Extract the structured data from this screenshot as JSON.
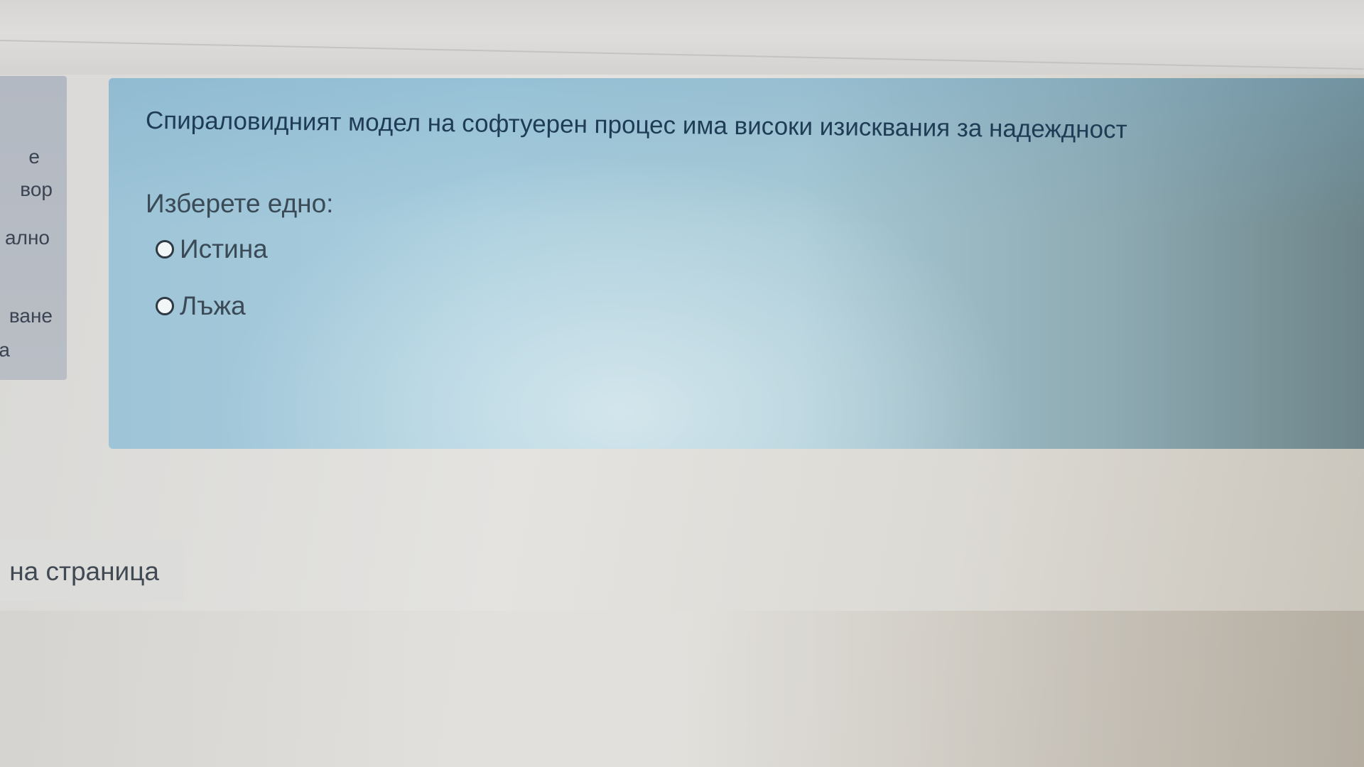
{
  "sidebar": {
    "fragments": [
      "е",
      "вор",
      "ално",
      "ване",
      "а"
    ]
  },
  "question": {
    "text": "Спираловидният модел на софтуерен процес има високи изисквания за надеждност",
    "prompt": "Изберете едно:",
    "options": [
      {
        "label": "Истина",
        "selected": false
      },
      {
        "label": "Лъжа",
        "selected": false
      }
    ]
  },
  "navigation": {
    "label": "на страница"
  }
}
